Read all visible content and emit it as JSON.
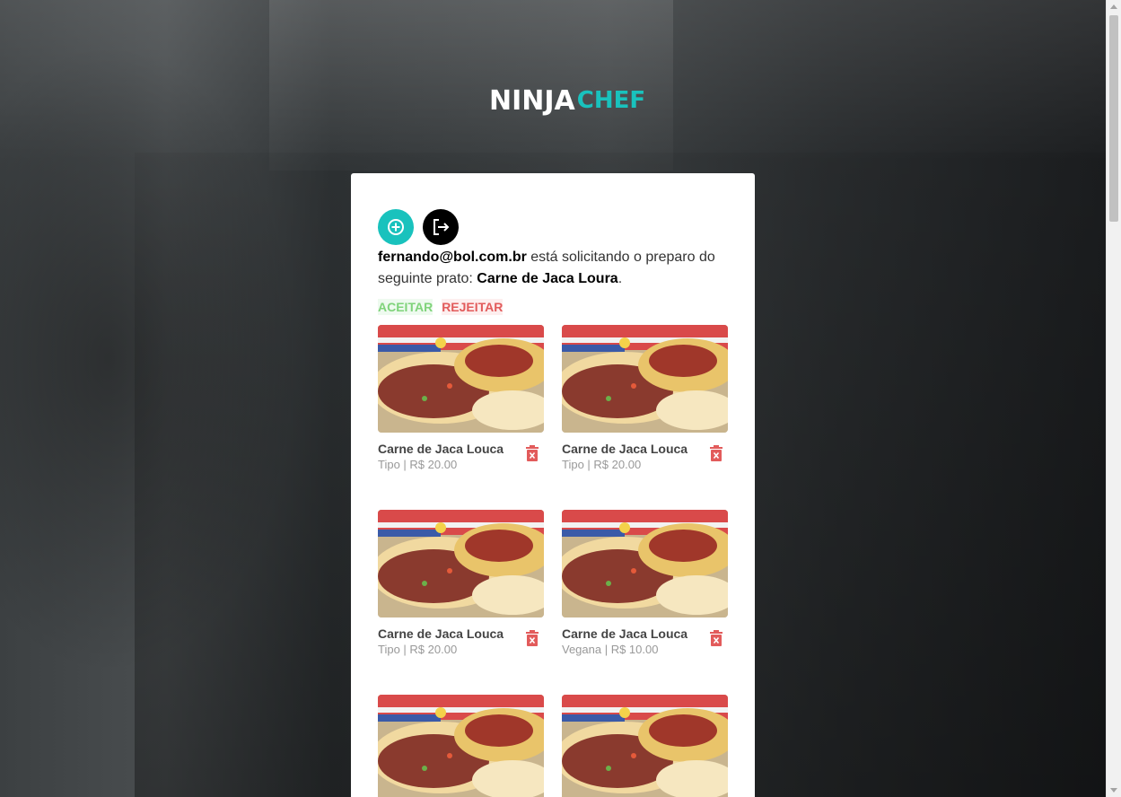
{
  "brand": {
    "logo_left": "NINJA",
    "logo_right": "CHEF"
  },
  "colors": {
    "accent": "#19c2bd",
    "accept": "#7fd37a",
    "reject": "#e25b5b"
  },
  "icons": {
    "add": "plus-circle-icon",
    "logout": "logout-icon",
    "delete": "trash-icon"
  },
  "request": {
    "email": "fernando@bol.com.br",
    "text_middle": " está solicitando o preparo do seguinte prato: ",
    "dish": "Carne de Jaca Loura",
    "end": "."
  },
  "actions": {
    "accept": "ACEITAR",
    "reject": "REJEITAR"
  },
  "dishes": [
    {
      "name": "Carne de Jaca Louca",
      "meta": "Tipo | R$ 20.00"
    },
    {
      "name": "Carne de Jaca Louca",
      "meta": "Tipo | R$ 20.00"
    },
    {
      "name": "Carne de Jaca Louca",
      "meta": "Tipo | R$ 20.00"
    },
    {
      "name": "Carne de Jaca Louca",
      "meta": "Vegana | R$ 10.00"
    },
    {
      "name": "",
      "meta": ""
    },
    {
      "name": "",
      "meta": ""
    }
  ]
}
